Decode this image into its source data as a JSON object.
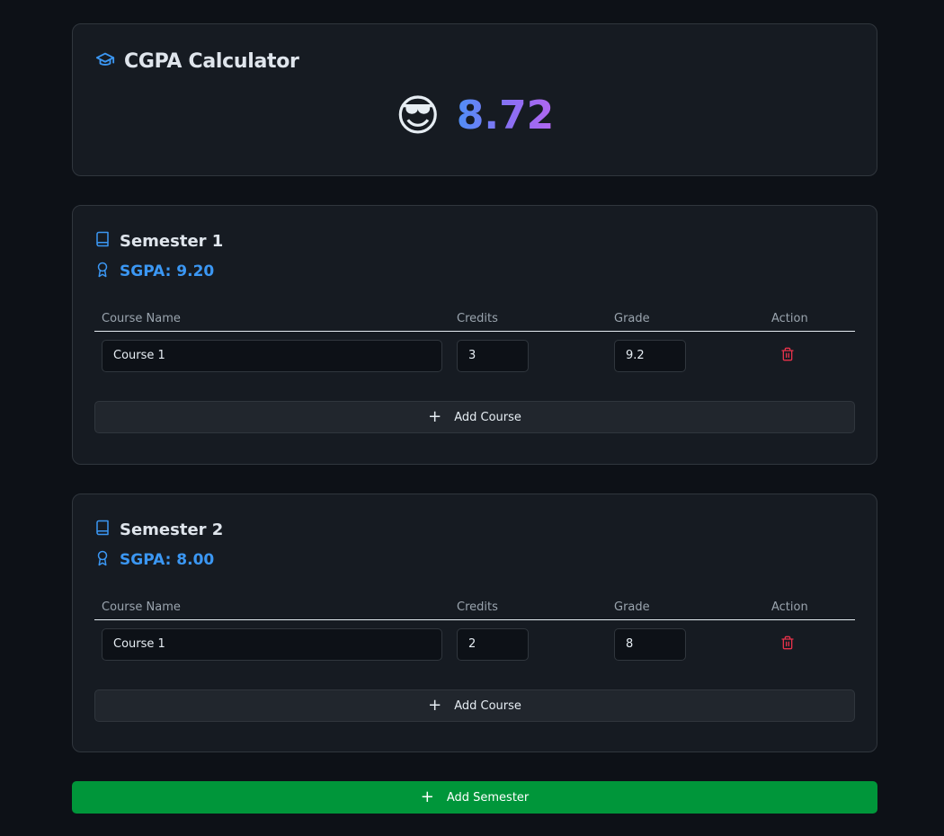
{
  "app": {
    "title": "CGPA Calculator",
    "cgpa": "8.72",
    "mood_emoji": "😎",
    "icons": {
      "title": "graduation-cap-icon",
      "semester": "book-icon",
      "sgpa": "award-icon",
      "delete": "trash-icon",
      "add": "plus-icon"
    }
  },
  "table_headers": {
    "course_name": "Course Name",
    "credits": "Credits",
    "grade": "Grade",
    "action": "Action"
  },
  "semesters": [
    {
      "title": "Semester 1",
      "sgpa": "SGPA: 9.20",
      "courses": [
        {
          "name": "Course 1",
          "credits": "3",
          "grade": "9.2"
        }
      ],
      "add_course_label": "Add Course"
    },
    {
      "title": "Semester 2",
      "sgpa": "SGPA: 8.00",
      "courses": [
        {
          "name": "Course 1",
          "credits": "2",
          "grade": "8"
        }
      ],
      "add_course_label": "Add Course"
    }
  ],
  "add_semester_label": "Add Semester",
  "colors": {
    "accent": "#3b97f3",
    "delete": "#e5324a",
    "add_semester": "#00963a",
    "background": "#0d1117",
    "card": "#161b22"
  }
}
